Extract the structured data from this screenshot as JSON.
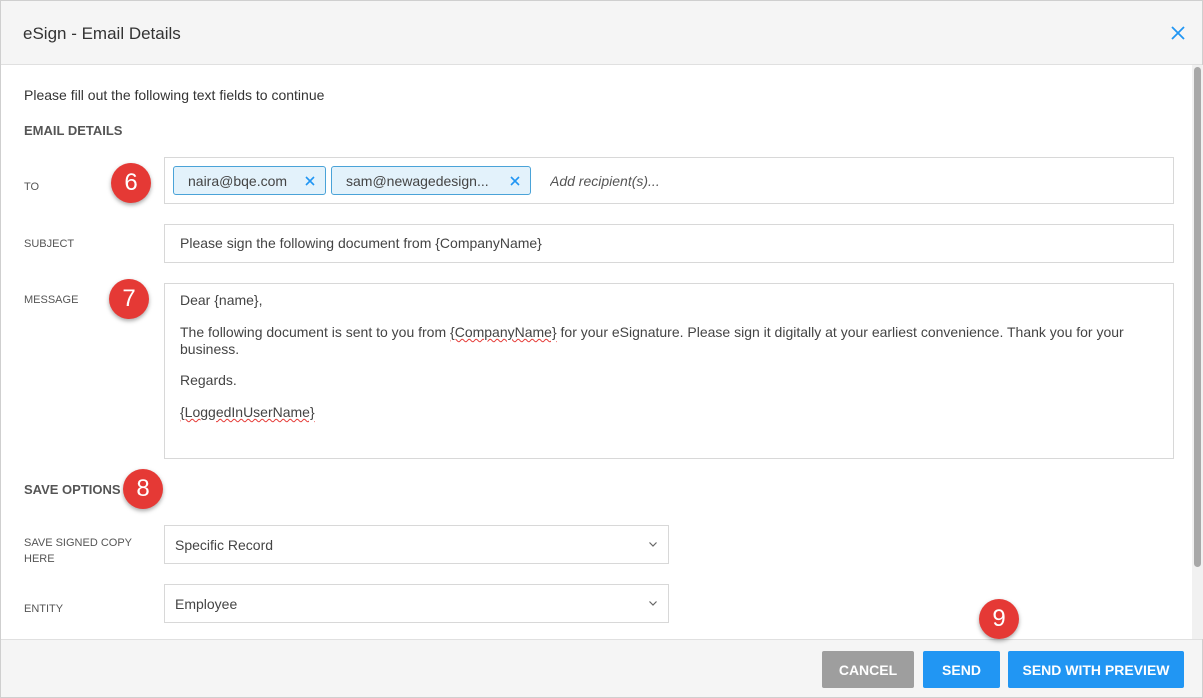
{
  "dialog": {
    "title": "eSign - Email Details"
  },
  "form": {
    "intro": "Please fill out the following text fields to continue",
    "email_details_title": "EMAIL DETAILS",
    "to_label": "TO",
    "recipients": [
      "naira@bqe.com",
      "sam@newagedesign..."
    ],
    "recipient_placeholder": "Add recipient(s)...",
    "subject_label": "SUBJECT",
    "subject_value": "Please sign the following document from {CompanyName}",
    "message_label": "MESSAGE",
    "message": {
      "greeting": "Dear {name},",
      "body_pre": "The following document is sent to you from ",
      "body_company": "{CompanyName}",
      "body_post": " for your eSignature. Please sign it digitally at your earliest convenience. Thank you for your business.",
      "regards": "Regards.",
      "signature": "{LoggedInUserName}"
    },
    "save_options_title": "SAVE OPTIONS",
    "save_copy_label_line1": "SAVE SIGNED COPY",
    "save_copy_label_line2": "HERE",
    "save_copy_value": "Specific Record",
    "entity_label": "ENTITY",
    "entity_value": "Employee"
  },
  "annotations": {
    "badge_6": "6",
    "badge_7": "7",
    "badge_8": "8",
    "badge_9": "9"
  },
  "footer": {
    "cancel_label": "CANCEL",
    "send_label": "SEND",
    "send_preview_label": "SEND WITH PREVIEW"
  },
  "colors": {
    "accent": "#2196f3",
    "cancel": "#9e9e9e",
    "chip_border": "#4aa3d8",
    "chip_bg": "#e3f2fb",
    "badge": "#e53935"
  },
  "icons": {
    "close": "close-icon",
    "chip_remove": "x-icon",
    "dropdown": "chevron-down-icon"
  }
}
